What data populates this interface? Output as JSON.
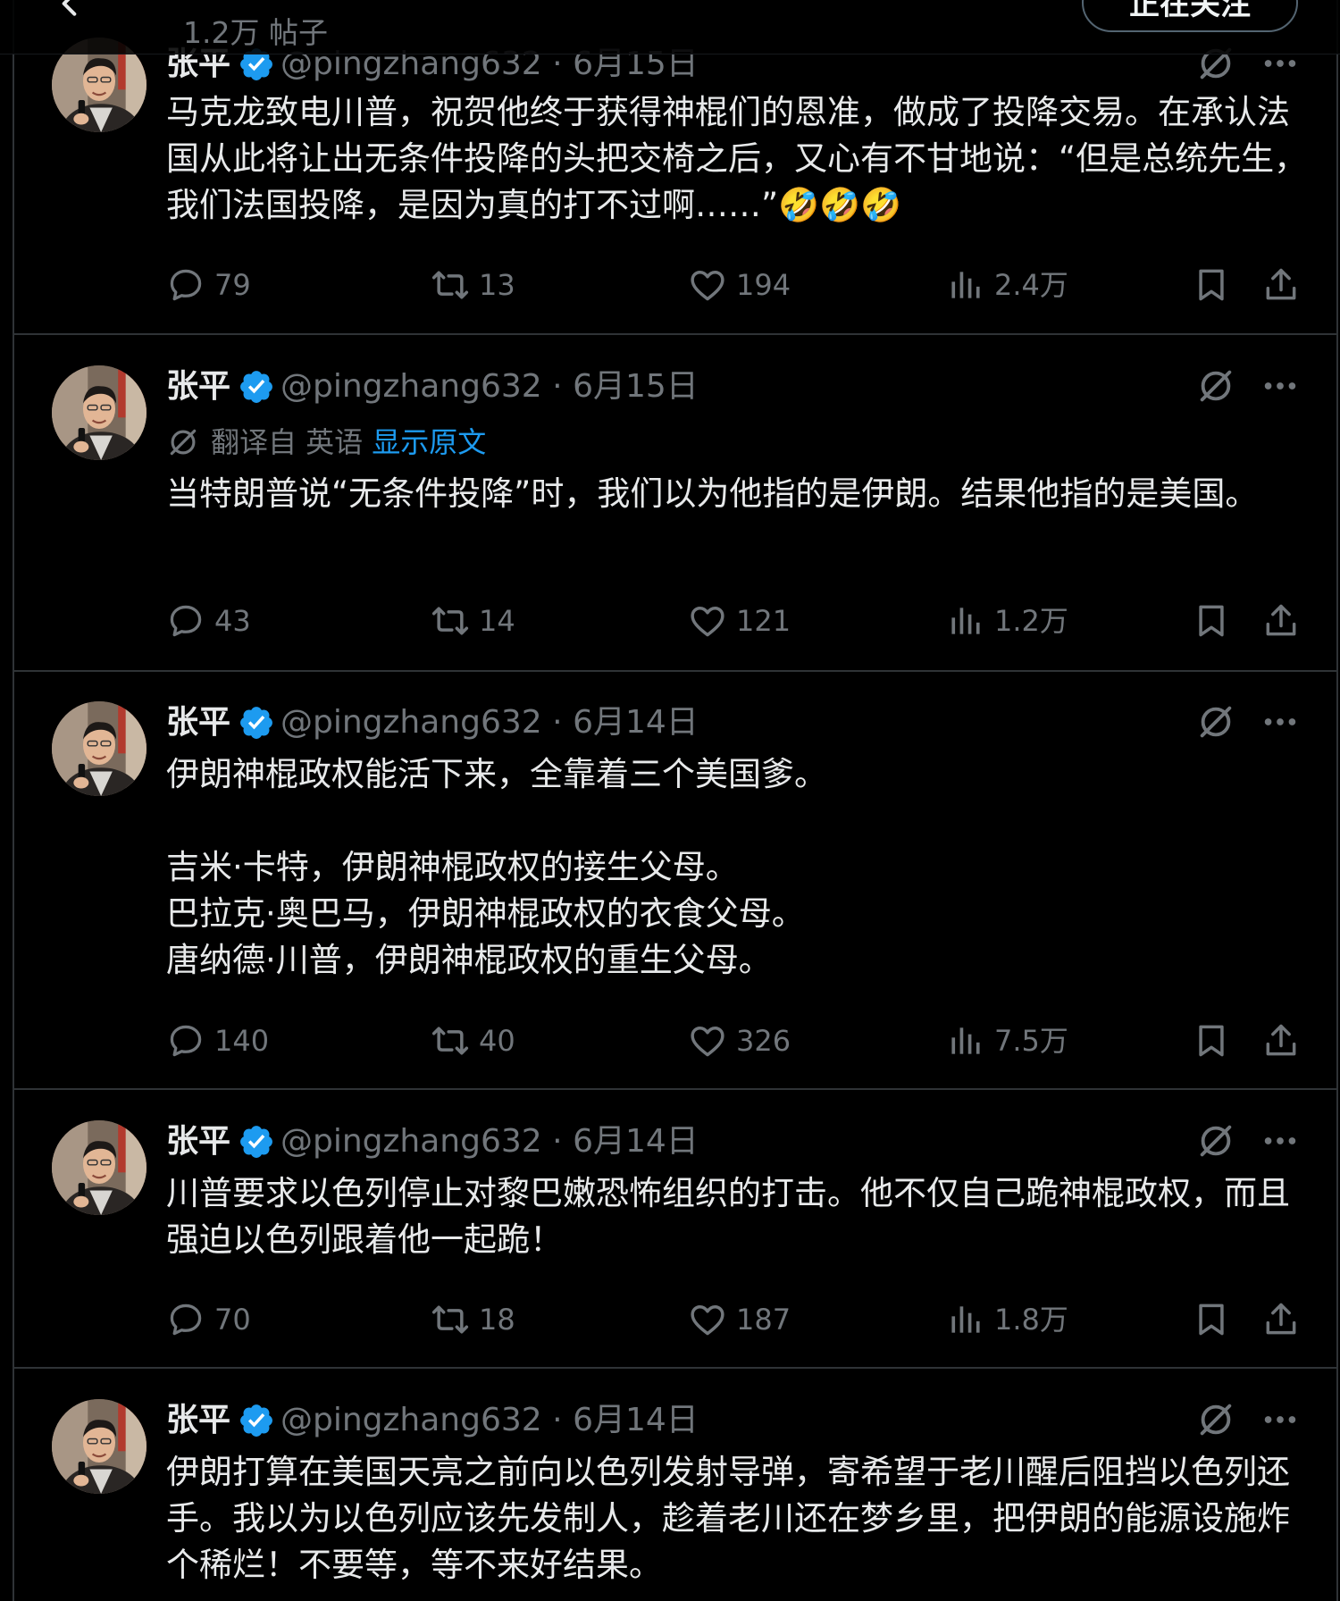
{
  "header": {
    "post_count": "1.2万 帖子",
    "follow_label": "正在关注"
  },
  "tweets": [
    {
      "name": "张平",
      "handle": "@pingzhang632",
      "sep": "·",
      "date": "6月15日",
      "text": "马克龙致电川普，祝贺他终于获得神棍们的恩准，做成了投降交易。在承认法国从此将让出无条件投降的头把交椅之后，又心有不甘地说：“但是总统先生，我们法国投降，是因为真的打不过啊……”🤣🤣🤣",
      "replies": "79",
      "retweets": "13",
      "likes": "194",
      "views": "2.4万"
    },
    {
      "name": "张平",
      "handle": "@pingzhang632",
      "sep": "·",
      "date": "6月15日",
      "translated_label": "翻译自 英语",
      "show_original": "显示原文",
      "text": "当特朗普说“无条件投降”时，我们以为他指的是伊朗。结果他指的是美国。",
      "replies": "43",
      "retweets": "14",
      "likes": "121",
      "views": "1.2万"
    },
    {
      "name": "张平",
      "handle": "@pingzhang632",
      "sep": "·",
      "date": "6月14日",
      "text": "伊朗神棍政权能活下来，全靠着三个美国爹。\n\n吉米·卡特，伊朗神棍政权的接生父母。\n巴拉克·奥巴马，伊朗神棍政权的衣食父母。\n唐纳德·川普，伊朗神棍政权的重生父母。",
      "replies": "140",
      "retweets": "40",
      "likes": "326",
      "views": "7.5万"
    },
    {
      "name": "张平",
      "handle": "@pingzhang632",
      "sep": "·",
      "date": "6月14日",
      "text": "川普要求以色列停止对黎巴嫩恐怖组织的打击。他不仅自己跪神棍政权，而且强迫以色列跟着他一起跪！",
      "replies": "70",
      "retweets": "18",
      "likes": "187",
      "views": "1.8万"
    },
    {
      "name": "张平",
      "handle": "@pingzhang632",
      "sep": "·",
      "date": "6月14日",
      "text": "伊朗打算在美国天亮之前向以色列发射导弹，寄希望于老川醒后阻挡以色列还手。我以为以色列应该先发制人，趁着老川还在梦乡里，把伊朗的能源设施炸个稀烂！不要等，等不来好结果。"
    }
  ]
}
